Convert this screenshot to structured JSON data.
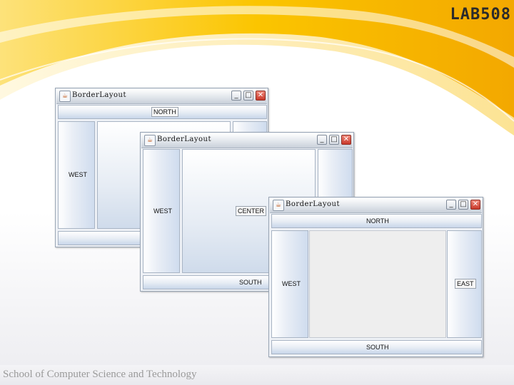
{
  "slide": {
    "brand": "LAB508",
    "footer": "School of Computer Science and Technology"
  },
  "windows": [
    {
      "title": "BorderLayout",
      "north": "NORTH",
      "west": "WEST",
      "center": "",
      "east": "",
      "south": ""
    },
    {
      "title": "BorderLayout",
      "north": "",
      "west": "WEST",
      "center": "CENTER",
      "east": "",
      "south": "SOUTH"
    },
    {
      "title": "BorderLayout",
      "north": "NORTH",
      "west": "WEST",
      "center": "",
      "east": "EAST",
      "south": "SOUTH"
    }
  ],
  "titlebar_buttons": {
    "minimize": "_",
    "maximize": "□",
    "close": "✕"
  },
  "icons": {
    "app": "java-cup-icon"
  },
  "colors": {
    "accent_gold": "#f7c200",
    "titlebar_blue": "#dfe4ea"
  }
}
